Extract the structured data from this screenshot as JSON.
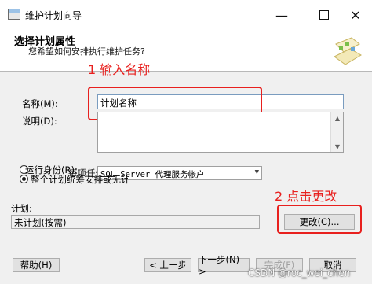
{
  "window": {
    "title": "维护计划向导",
    "minimize_icon": "minimize-icon",
    "maximize_icon": "maximize-icon",
    "close_icon": "close-icon"
  },
  "header": {
    "title": "选择计划属性",
    "subtitle": "您希望如何安排执行维护任务?"
  },
  "annotations": {
    "step1": "1 输入名称",
    "step2": "2 点击更改"
  },
  "form": {
    "name_label": "名称(M):",
    "name_value": "计划名称",
    "description_label": "说明(D):",
    "description_value": "",
    "run_as_label": "运行身份(R):",
    "run_as_value": "SQL Server 代理服务帐户",
    "radio_separate": "每项任务单独计划",
    "radio_whole": "整个计划统筹安排或无计划",
    "schedule_label": "计划:",
    "schedule_value": "未计划(按需)",
    "change_button": "更改(C)..."
  },
  "footer": {
    "help": "帮助(H)",
    "back": "< 上一步",
    "next": "下一步(N) >",
    "finish": "完成(F)",
    "cancel": "取消"
  },
  "watermark": "CSDN @roc_wei_chen",
  "colors": {
    "annotation": "#e8201e",
    "window_bg": "#f0f0f0"
  }
}
